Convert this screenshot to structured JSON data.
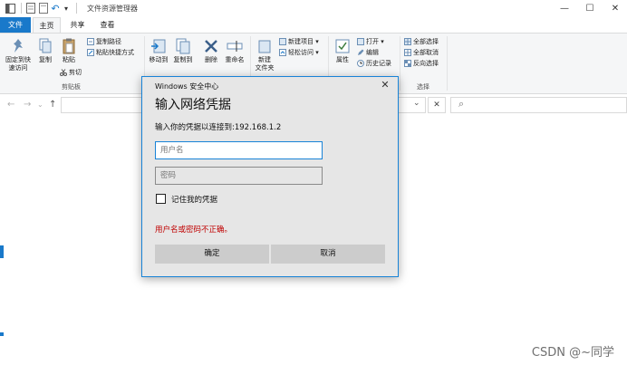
{
  "window": {
    "title": "文件资源管理器",
    "controls": {
      "minimize": "—",
      "maximize": "☐",
      "close": "✕"
    }
  },
  "quick_access": {
    "undo": "↶",
    "dropdown": "▾"
  },
  "tabs": [
    {
      "label": "文件",
      "kind": "file"
    },
    {
      "label": "主页",
      "kind": "active"
    },
    {
      "label": "共享",
      "kind": "normal"
    },
    {
      "label": "查看",
      "kind": "normal"
    }
  ],
  "ribbon": {
    "clipboard": {
      "pin_label1": "固定到快",
      "pin_label2": "速访问",
      "copy_label": "复制",
      "paste_label": "粘贴",
      "copy_path": "复制路径",
      "paste_shortcut": "粘贴快捷方式",
      "cut": "剪切",
      "group_label": "剪贴板"
    },
    "organize": {
      "move_to": "移动到",
      "copy_to": "复制到",
      "delete": "删除",
      "rename": "重命名"
    },
    "new": {
      "new_folder1": "新建",
      "new_folder2": "文件夹",
      "new_item": "新建项目 ▾",
      "easy_access": "轻松访问 ▾"
    },
    "open": {
      "properties": "属性",
      "open": "打开 ▾",
      "edit": "编辑",
      "history": "历史记录"
    },
    "select": {
      "select_all": "全部选择",
      "select_none": "全部取消",
      "invert": "反向选择",
      "group_label": "选择"
    }
  },
  "address_bar": {
    "back": "←",
    "forward": "→",
    "down": "⌄",
    "up": "↑",
    "clear": "✕",
    "search_icon": "⌕"
  },
  "dialog": {
    "title": "Windows 安全中心",
    "close": "✕",
    "heading": "输入网络凭据",
    "subtitle": "输入你的凭据以连接到:192.168.1.2",
    "username_placeholder": "用户名",
    "password_placeholder": "密码",
    "remember_label": "记住我的凭据",
    "error_text": "用户名或密码不正确。",
    "ok_label": "确定",
    "cancel_label": "取消"
  },
  "watermark": "CSDN @~同学",
  "colors": {
    "accent": "#1979ca",
    "dialog_border": "#1883d7",
    "error": "#c00000"
  }
}
